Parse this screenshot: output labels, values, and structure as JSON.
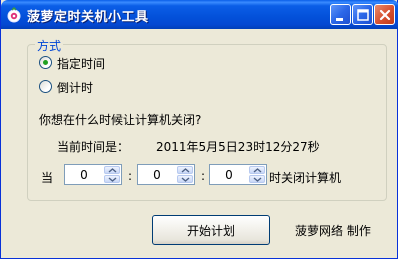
{
  "window": {
    "title": "菠萝定时关机小工具"
  },
  "mode_group": {
    "legend": "方式",
    "options": [
      {
        "label": "指定时间",
        "checked": true
      },
      {
        "label": "倒计时",
        "checked": false
      }
    ]
  },
  "question": "你想在什么时候让计算机关闭?",
  "current_time": {
    "label": "当前时间是：",
    "value": "2011年5月5日23时12分27秒"
  },
  "schedule": {
    "prefix": "当",
    "spinners": [
      "0",
      "0",
      "0"
    ],
    "separator": ":",
    "suffix": "时关闭计算机"
  },
  "start_button": {
    "label": "开始计划"
  },
  "credit": "菠萝网络 制作"
}
